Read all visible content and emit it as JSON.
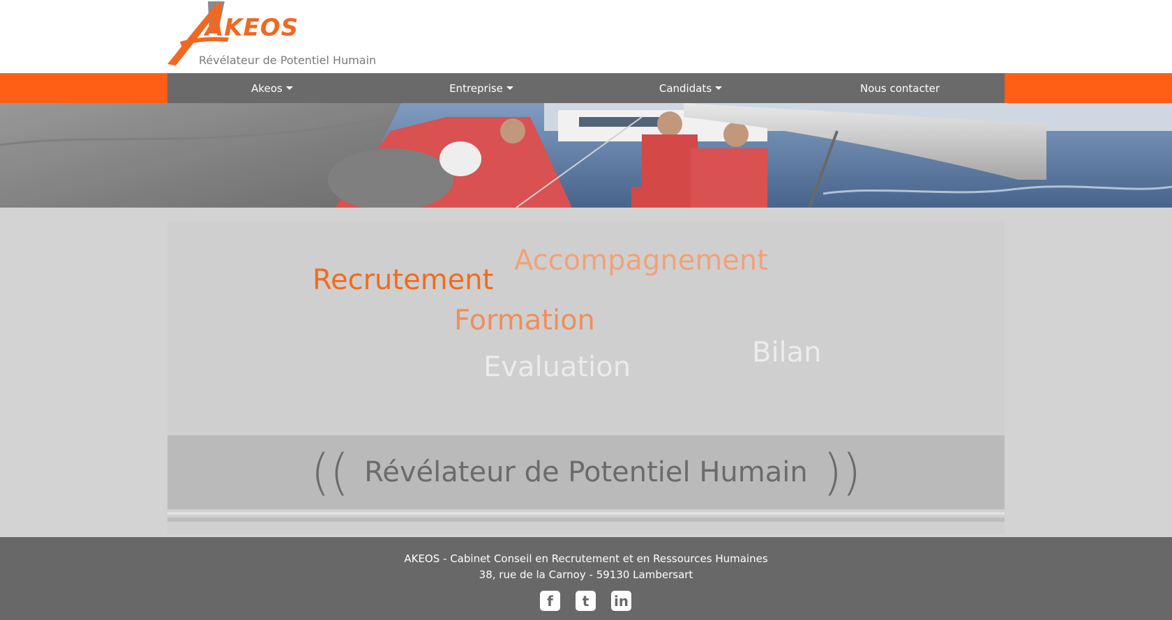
{
  "brand": {
    "name": "AKEOS",
    "tagline": "Révélateur de Potentiel Humain",
    "accent_color": "#ff5e14",
    "nav_bg_color": "#6a6a6a"
  },
  "nav": {
    "items": [
      {
        "label": "Akeos",
        "has_dropdown": true
      },
      {
        "label": "Entreprise",
        "has_dropdown": true
      },
      {
        "label": "Candidats",
        "has_dropdown": true
      },
      {
        "label": "Nous contacter",
        "has_dropdown": false
      }
    ]
  },
  "hero": {
    "image": "sailing-crew-photo"
  },
  "word_cloud": {
    "recrutement": "Recrutement",
    "accompagnement": "Accompagnement",
    "formation": "Formation",
    "evaluation": "Evaluation",
    "bilan": "Bilan"
  },
  "banner": {
    "open": "((",
    "text": "Révélateur de Potentiel Humain",
    "close": "))"
  },
  "footer": {
    "line1": "AKEOS - Cabinet Conseil en Recrutement et en Ressources Humaines",
    "line2": "38, rue de la Carnoy - 59130 Lambersart",
    "socials": [
      {
        "name": "facebook-icon",
        "glyph": "f"
      },
      {
        "name": "twitter-icon",
        "glyph": "t"
      },
      {
        "name": "linkedin-icon",
        "glyph": "in"
      }
    ]
  }
}
